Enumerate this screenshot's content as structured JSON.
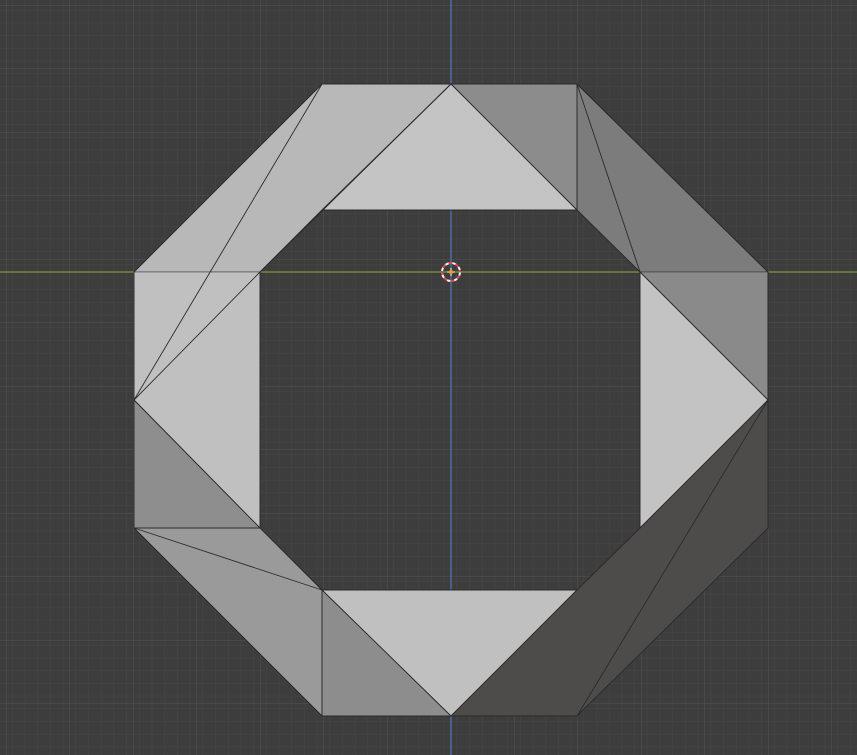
{
  "viewport": {
    "background_color": "#3d3d3d",
    "grid_minor_color": "#474747",
    "grid_major_color": "#515151",
    "x_axis_color": "#7a9a3a",
    "y_axis_color": "#4f6fa8",
    "cursor_icon": "3d-cursor-icon",
    "cursor_colors": [
      "#d94a4a",
      "#f2f2f2"
    ]
  },
  "mesh": {
    "name": "octagon-ring",
    "shade_colors": {
      "light": "#c2c2c2",
      "mid_light": "#aeaeae",
      "mid": "#8f8f8f",
      "mid_dark": "#7a7a7a",
      "dark": "#4d4a4a",
      "edge": "#2b2b2b"
    }
  }
}
